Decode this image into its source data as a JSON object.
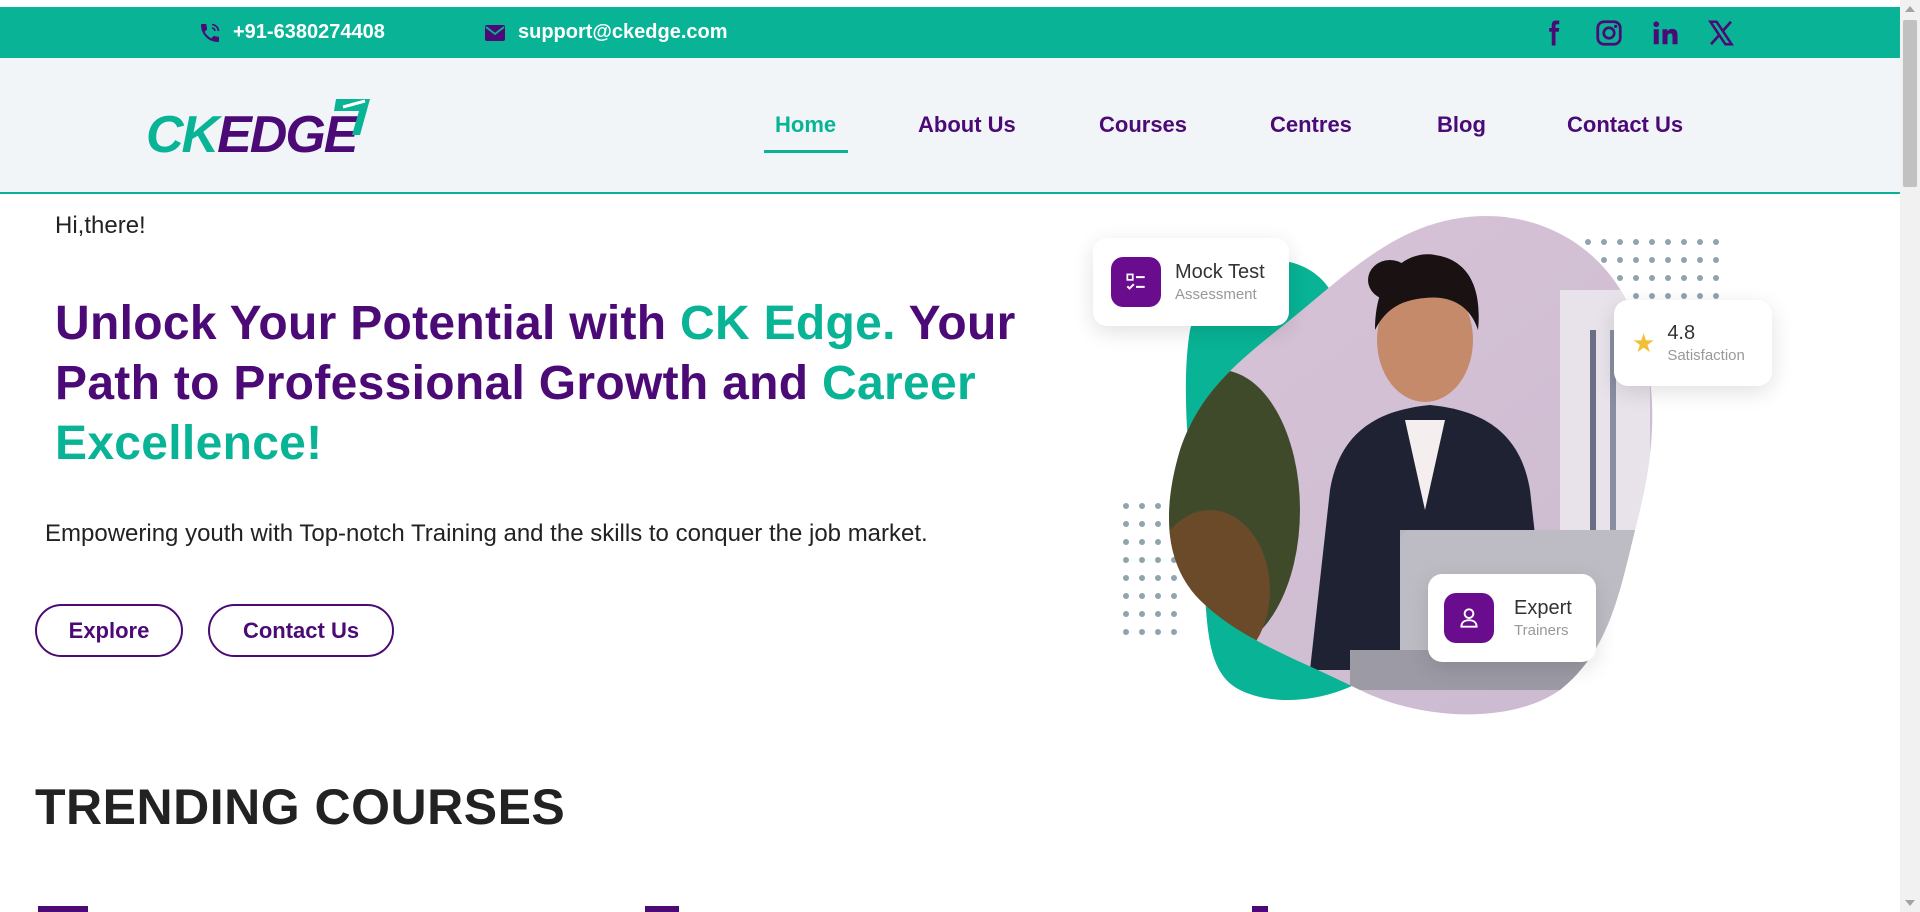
{
  "topbar": {
    "phone": "+91-6380274408",
    "email": "support@ckedge.com",
    "social": [
      "facebook-icon",
      "instagram-icon",
      "linkedin-icon",
      "x-icon"
    ],
    "bg_color": "#08b495"
  },
  "header": {
    "logo_text": "CKEDGE",
    "nav": [
      "Home",
      "About Us",
      "Courses",
      "Centres",
      "Blog",
      "Contact Us"
    ],
    "active_nav": "Home"
  },
  "hero": {
    "greeting": "Hi,there!",
    "headline_parts": [
      "Unlock Your Potential with ",
      "CK Edge.",
      " Your Path to Professional Growth and ",
      "Career Excellence!"
    ],
    "subtext": "Empowering youth with Top-notch Training and the skills to conquer the job market.",
    "buttons": [
      "Explore",
      "Contact Us"
    ],
    "cards": {
      "mock_title": "Mock Test",
      "mock_sub": "Assessment",
      "rating_value": "4.8",
      "rating_sub": "Satisfaction",
      "expert_title": "Expert",
      "expert_sub": "Trainers"
    }
  },
  "sections": {
    "trending_title": "TRENDING COURSES"
  },
  "colors": {
    "brand_purple": "#4b0a75",
    "brand_teal": "#08b495",
    "header_bg": "#f2f5f8"
  }
}
